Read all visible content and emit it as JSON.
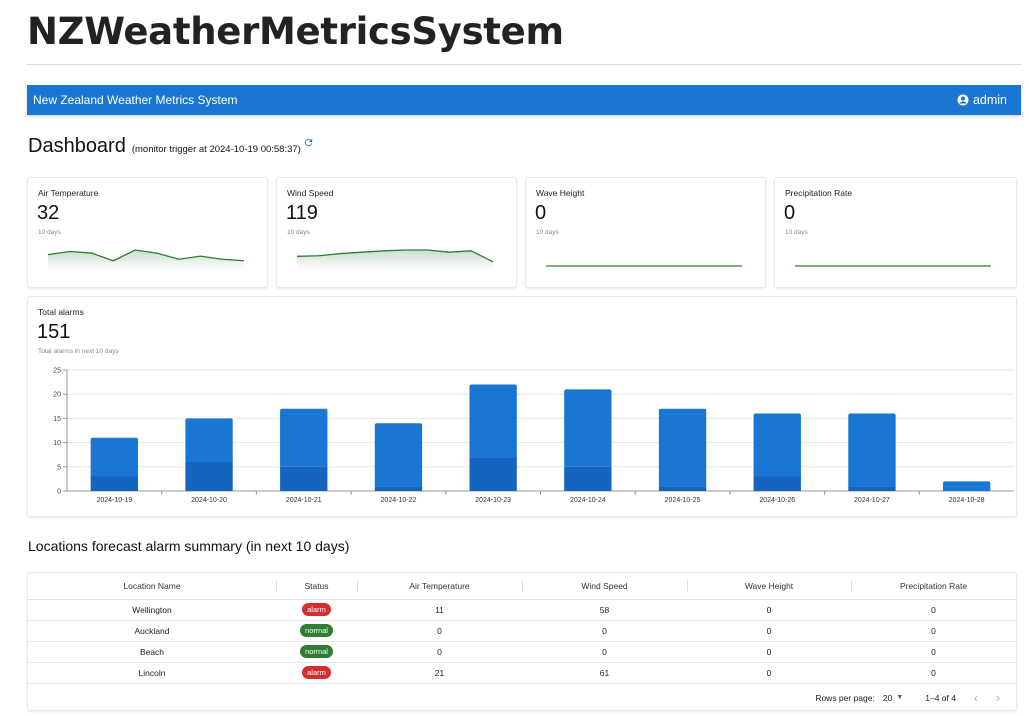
{
  "page": {
    "title": "NZWeatherMetricsSystem"
  },
  "appbar": {
    "title": "New Zealand Weather Metrics System",
    "user": "admin"
  },
  "dashboard": {
    "title": "Dashboard",
    "subtitle": "(monitor trigger at 2024-10-19 00:58:37)"
  },
  "metrics": [
    {
      "name": "Air Temperature",
      "value": "32",
      "caption": "10 days",
      "spark": [
        5,
        6,
        5.5,
        3,
        6.5,
        5.5,
        3.5,
        4.5,
        3.5,
        3
      ]
    },
    {
      "name": "Wind Speed",
      "value": "119",
      "caption": "10 days",
      "spark": [
        5,
        5.2,
        6,
        6.5,
        7,
        7.3,
        7.3,
        6.5,
        7,
        3
      ]
    },
    {
      "name": "Wave Height",
      "value": "0",
      "caption": "10 days",
      "spark": [
        0,
        0,
        0,
        0,
        0,
        0,
        0,
        0,
        0,
        0
      ]
    },
    {
      "name": "Precipitation Rate",
      "value": "0",
      "caption": "10 days",
      "spark": [
        0,
        0,
        0,
        0,
        0,
        0,
        0,
        0,
        0,
        0
      ]
    }
  ],
  "alarms_card": {
    "title": "Total alarms",
    "value": "151",
    "caption": "Total alarms in next 10 days"
  },
  "chart_data": {
    "type": "bar",
    "stacked": true,
    "categories": [
      "2024-10-19",
      "2024-10-20",
      "2024-10-21",
      "2024-10-22",
      "2024-10-23",
      "2024-10-24",
      "2024-10-25",
      "2024-10-26",
      "2024-10-27",
      "2024-10-28"
    ],
    "series": [
      {
        "values": [
          3,
          6,
          5,
          1,
          7,
          5,
          1,
          3,
          1,
          0
        ],
        "color": "#1565c0"
      },
      {
        "values": [
          8,
          9,
          12,
          13,
          15,
          16,
          16,
          13,
          15,
          2
        ],
        "color": "#1976d2"
      }
    ],
    "yticks": [
      "0",
      "5",
      "10",
      "15",
      "20",
      "25"
    ],
    "ylim": [
      0,
      25
    ],
    "grid": true
  },
  "summary": {
    "title": "Locations forecast alarm summary (in next 10 days)",
    "columns": [
      "Location Name",
      "Status",
      "Air Temperature",
      "Wind Speed",
      "Wave Height",
      "Precipitation Rate"
    ],
    "rows": [
      [
        "Wellington",
        "alarm",
        "11",
        "58",
        "0",
        "0"
      ],
      [
        "Auckland",
        "normal",
        "0",
        "0",
        "0",
        "0"
      ],
      [
        "Beach",
        "normal",
        "0",
        "0",
        "0",
        "0"
      ],
      [
        "Lincoln",
        "alarm",
        "21",
        "61",
        "0",
        "0"
      ]
    ],
    "footer": {
      "rows_label": "Rows per page:",
      "rows_value": "20",
      "range": "1–4 of 4"
    }
  },
  "colors": {
    "primary": "#1976d2",
    "spark": "#2e7d32",
    "alarm": "#d32f2f",
    "normal": "#2e7d32"
  }
}
